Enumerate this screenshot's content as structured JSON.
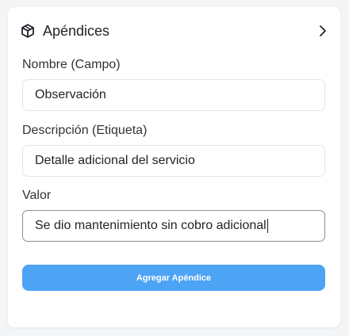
{
  "section": {
    "title": "Apéndices",
    "icon": "cube-icon",
    "expand_icon": "chevron-right-icon"
  },
  "fields": {
    "name": {
      "label": "Nombre (Campo)",
      "value": "Observación"
    },
    "description": {
      "label": "Descripción (Etiqueta)",
      "value": "Detalle adicional del servicio"
    },
    "value": {
      "label": "Valor",
      "value": "Se dio mantenimiento sin cobro adicional"
    }
  },
  "actions": {
    "add_label": "Agregar Apéndice"
  },
  "colors": {
    "accent": "#4da3f4",
    "background": "#f4f5f7",
    "card": "#ffffff"
  }
}
